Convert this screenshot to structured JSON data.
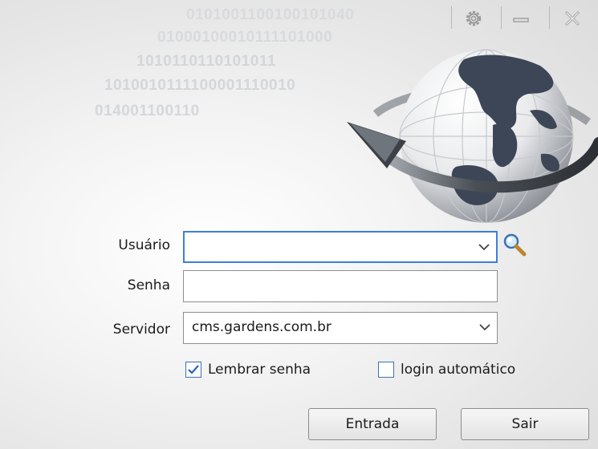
{
  "background_binary": [
    "0101001100100101040",
    "01000100010111101000",
    "1010110110101011",
    "1010010111100001110010",
    "014001100110"
  ],
  "titlebar": {
    "settings_icon": "gear-icon",
    "minimize_icon": "minimize-icon",
    "close_icon": "close-icon"
  },
  "form": {
    "usuario_label": "Usuário",
    "usuario_value": "",
    "senha_label": "Senha",
    "senha_value": "",
    "servidor_label": "Servidor",
    "servidor_value": "cms.gardens.com.br",
    "lembrar_label": "Lembrar senha",
    "lembrar_checked": true,
    "auto_label": "login automático",
    "auto_checked": false
  },
  "buttons": {
    "entrada": "Entrada",
    "sair": "Sair"
  },
  "colors": {
    "focus_border": "#3d7fd6",
    "checkbox_border": "#3b72b8"
  }
}
